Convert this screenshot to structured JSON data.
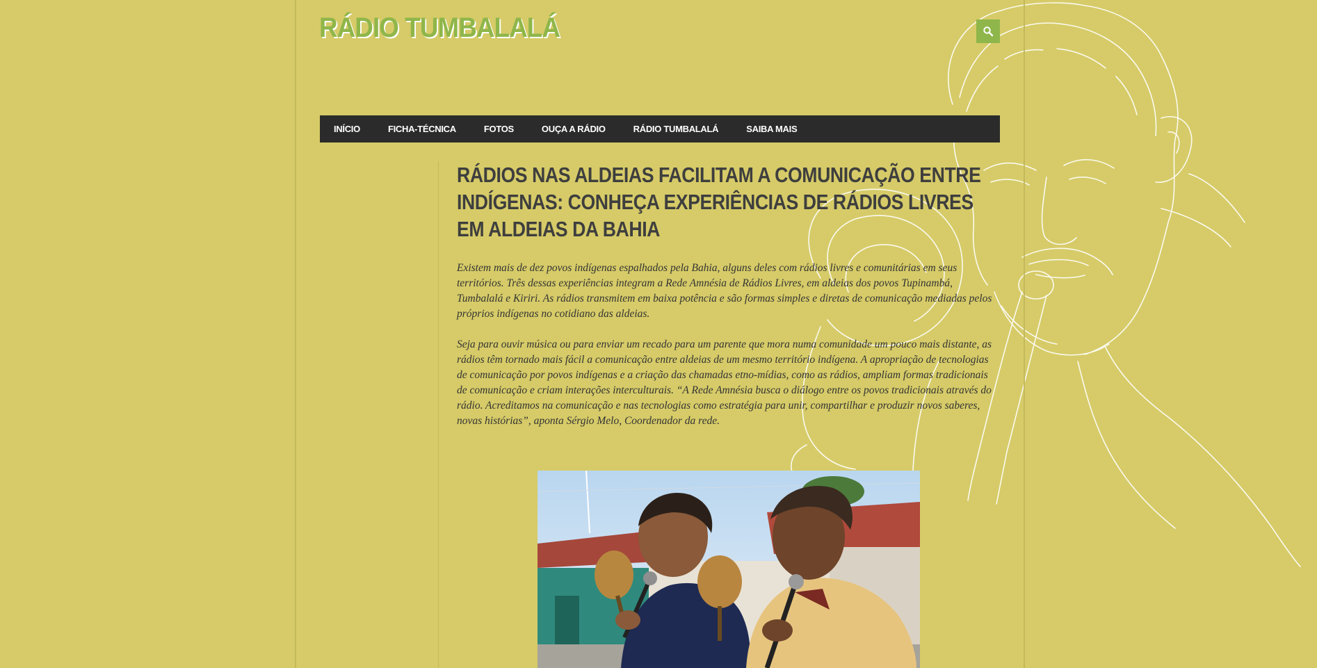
{
  "site": {
    "title": "RÁDIO TUMBALALÁ"
  },
  "header": {
    "search_icon": "search-icon"
  },
  "nav": {
    "items": [
      {
        "label": "INÍCIO"
      },
      {
        "label": "FICHA-TÉCNICA"
      },
      {
        "label": "FOTOS"
      },
      {
        "label": "OUÇA A RÁDIO"
      },
      {
        "label": "RÁDIO TUMBALALÁ"
      },
      {
        "label": "SAIBA MAIS"
      }
    ]
  },
  "article": {
    "title": "RÁDIOS NAS ALDEIAS FACILITAM A COMUNICAÇÃO ENTRE INDÍGENAS: CONHEÇA EXPERIÊNCIAS DE RÁDIOS LIVRES EM ALDEIAS DA BAHIA",
    "paragraphs": [
      "Existem mais de dez povos indígenas espalhados pela Bahia, alguns deles com rádios livres e comunitárias em seus territórios. Três dessas experiências integram a Rede Amnésia de Rádios Livres, em aldeias dos povos Tupinambá, Tumbalalá e Kiriri. As rádios transmitem em baixa potência e são formas simples e diretas de comunicação mediadas pelos próprios indígenas no cotidiano das aldeias.",
      "Seja para ouvir música ou para enviar um recado para um parente que mora numa comunidade um pouco mais distante, as rádios têm tornado mais fácil a comunicação entre aldeias de um mesmo território indígena. A apropriação de tecnologias de comunicação por povos indígenas e a criação das chamadas etno-mídias, como as rádios, ampliam formas tradicionais de comunicação e criam interações interculturais. “A Rede Amnésia busca o diálogo entre os povos tradicionais através do rádio. Acreditamos na comunicação e nas tecnologias como estratégia para unir, compartilhar e produzir novos saberes, novas histórias”, aponta Sérgio Melo, Coordenador da rede."
    ]
  },
  "colors": {
    "background": "#d6cb68",
    "accent": "#8fb64a",
    "nav_bg": "#2b2b2b",
    "title_text": "#3e3e3e"
  }
}
